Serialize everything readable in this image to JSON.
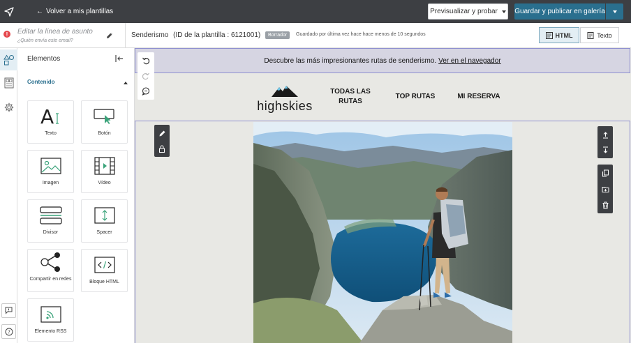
{
  "topbar": {
    "back_label": "Volver a mis plantillas",
    "preview_label": "Previsualizar y probar",
    "save_label": "Guardar y publicar en galería"
  },
  "subject": {
    "placeholder": "Editar la línea de asunto",
    "subtext": "¿Quién envía este email?"
  },
  "info": {
    "template_name": "Senderismo",
    "template_id": "(ID de la plantilla : 6121001)",
    "badge": "Borrador",
    "saved": "Guardado por última vez hace hace menos de 10 segundos",
    "view_html": "HTML",
    "view_text": "Texto"
  },
  "panel": {
    "title": "Elementos",
    "section": "Contenido",
    "tiles": [
      {
        "label": "Texto",
        "icon": "text-icon"
      },
      {
        "label": "Botón",
        "icon": "button-icon"
      },
      {
        "label": "Imagen",
        "icon": "image-icon"
      },
      {
        "label": "Vídeo",
        "icon": "video-icon"
      },
      {
        "label": "Divisor",
        "icon": "divider-icon"
      },
      {
        "label": "Spacer",
        "icon": "spacer-icon"
      },
      {
        "label": "Compartir en redes",
        "icon": "share-icon"
      },
      {
        "label": "Bloque HTML",
        "icon": "html-block-icon"
      },
      {
        "label": "Elemento RSS",
        "icon": "rss-icon"
      }
    ]
  },
  "canvas": {
    "preheader_text": "Descubre las más impresionantes rutas de senderismo.",
    "preheader_link": "Ver en el navegador",
    "brand": "highskies",
    "nav": [
      "TODAS LAS",
      "RUTAS",
      "TOP RUTAS",
      "MI RESERVA"
    ]
  },
  "colors": {
    "topbar": "#3d3f43",
    "accent": "#2a6f8e",
    "alert": "#e5484d",
    "selection": "#8e8fd0"
  }
}
